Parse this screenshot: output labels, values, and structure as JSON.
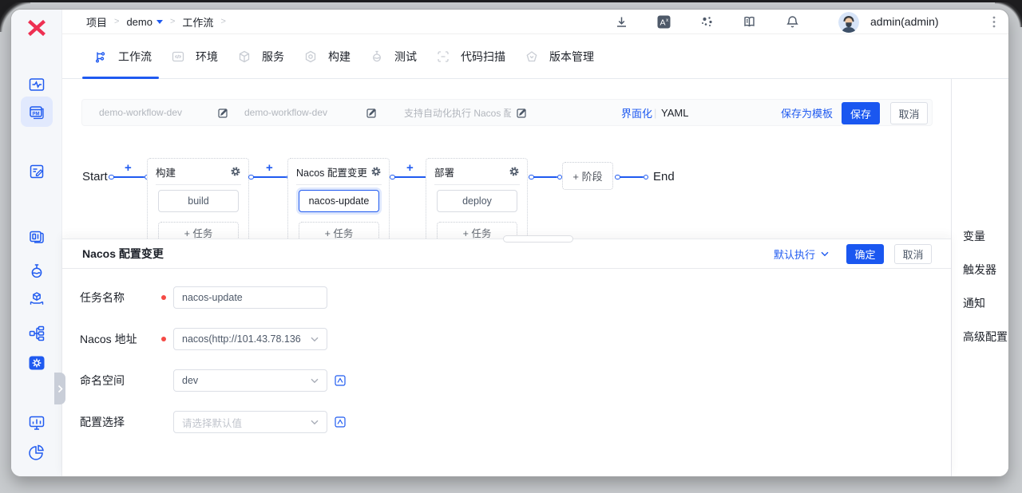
{
  "breadcrumb": {
    "items": [
      "项目",
      "demo",
      "工作流"
    ]
  },
  "header": {
    "user": "admin(admin)"
  },
  "tabs": [
    {
      "label": "工作流"
    },
    {
      "label": "环境"
    },
    {
      "label": "服务"
    },
    {
      "label": "构建"
    },
    {
      "label": "测试"
    },
    {
      "label": "代码扫描"
    },
    {
      "label": "版本管理"
    }
  ],
  "workflow_bar": {
    "name": "demo-workflow-dev",
    "display_name": "demo-workflow-dev",
    "description": "支持自动化执行 Nacos 配置",
    "view_ui": "界面化",
    "view_yaml": "YAML",
    "save_as_template": "保存为模板",
    "save": "保存",
    "cancel": "取消"
  },
  "canvas": {
    "start": "Start",
    "end": "End",
    "add_stage": "+ 阶段",
    "stages": [
      {
        "title": "构建",
        "job": "build",
        "add_task": "+ 任务"
      },
      {
        "title": "Nacos 配置变更",
        "job": "nacos-update",
        "add_task": "+ 任务"
      },
      {
        "title": "部署",
        "job": "deploy",
        "add_task": "+ 任务"
      }
    ]
  },
  "drawer": {
    "title": "Nacos 配置变更",
    "exec_mode": "默认执行",
    "confirm": "确定",
    "cancel": "取消",
    "fields": [
      {
        "label": "任务名称",
        "value": "nacos-update"
      },
      {
        "label": "Nacos 地址",
        "value": "nacos(http://101.43.78.136"
      },
      {
        "label": "命名空间",
        "value": "dev"
      },
      {
        "label": "配置选择",
        "placeholder": "请选择默认值"
      }
    ]
  },
  "right_panel": {
    "items": [
      "变量",
      "触发器",
      "通知",
      "高级配置"
    ]
  }
}
